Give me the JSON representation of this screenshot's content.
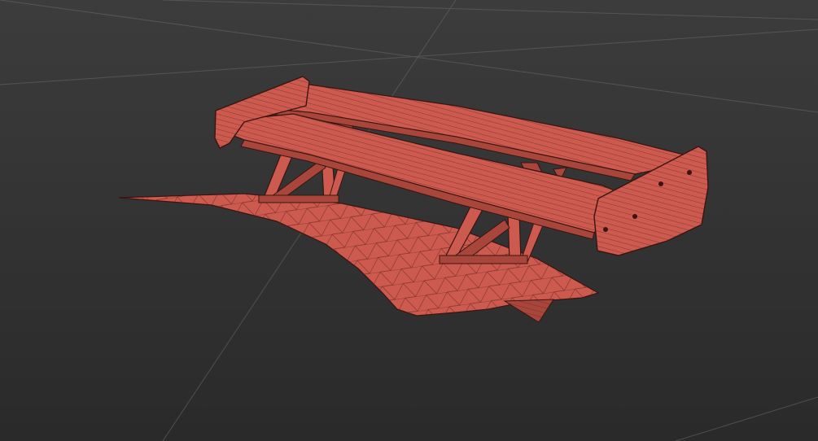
{
  "viewport": {
    "background_top": "#3c3c3c",
    "background_bottom": "#2a2a2a",
    "grid_color": "#6b6b6b"
  },
  "model": {
    "fill_color": "#cc5a4e",
    "fill_shade": "#a8463c",
    "wire_color": "#5a1f1a",
    "edge_color": "#3a1410"
  }
}
